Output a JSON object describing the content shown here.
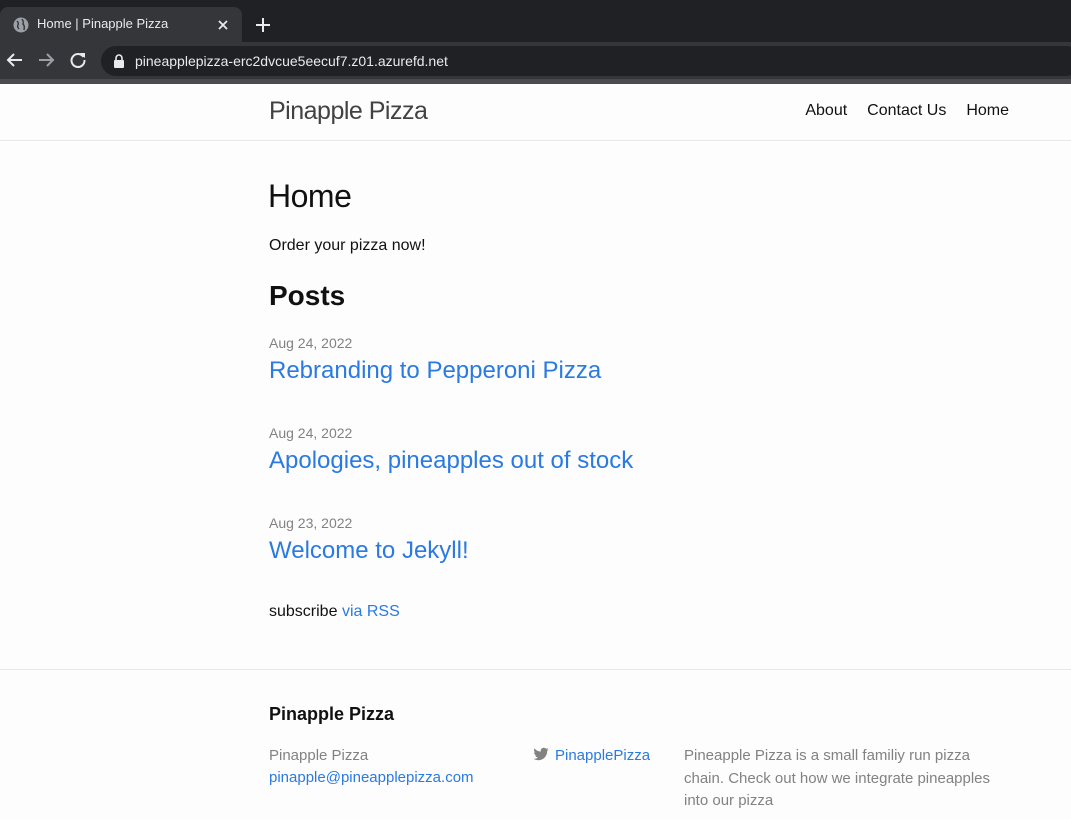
{
  "browser": {
    "tab_title": "Home | Pinapple Pizza",
    "url": "pineapplepizza-erc2dvcue5eecuf7.z01.azurefd.net"
  },
  "header": {
    "site_title": "Pinapple Pizza",
    "nav": [
      "About",
      "Contact Us",
      "Home"
    ]
  },
  "main": {
    "page_heading": "Home",
    "intro": "Order your pizza now!",
    "posts_heading": "Posts",
    "posts": [
      {
        "date": "Aug 24, 2022",
        "title": "Rebranding to Pepperoni Pizza"
      },
      {
        "date": "Aug 24, 2022",
        "title": "Apologies, pineapples out of stock"
      },
      {
        "date": "Aug 23, 2022",
        "title": "Welcome to Jekyll!"
      }
    ],
    "subscribe_text": "subscribe",
    "rss_link": "via RSS"
  },
  "footer": {
    "heading": "Pinapple Pizza",
    "name": "Pinapple Pizza",
    "email": "pinapple@pineapplepizza.com",
    "twitter_handle": "PinapplePizza",
    "description": "Pineapple Pizza is a small familiy run pizza chain. Check out how we integrate pineapples into our pizza"
  },
  "colors": {
    "link": "#2a7ae2",
    "meta": "#828282",
    "chrome_dark": "#202124",
    "chrome_toolbar": "#35363a"
  },
  "icons": [
    "globe-icon",
    "close-icon",
    "plus-icon",
    "back-arrow-icon",
    "forward-arrow-icon",
    "reload-icon",
    "lock-icon",
    "twitter-icon"
  ]
}
